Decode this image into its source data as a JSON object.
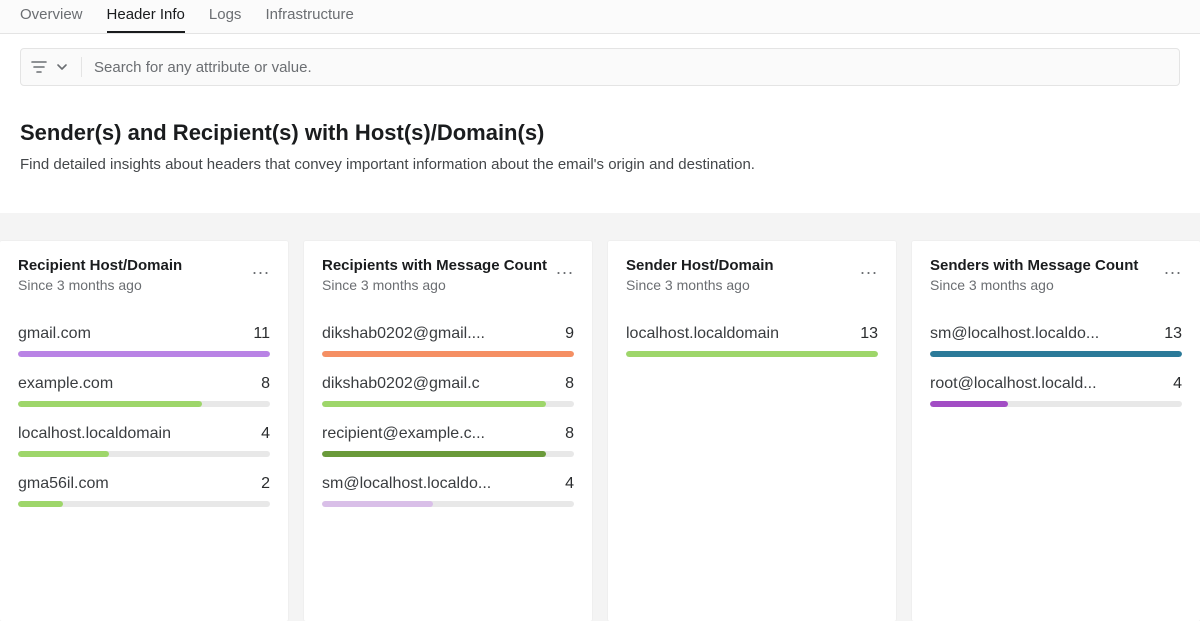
{
  "tabs": [
    {
      "label": "Overview",
      "active": false
    },
    {
      "label": "Header Info",
      "active": true
    },
    {
      "label": "Logs",
      "active": false
    },
    {
      "label": "Infrastructure",
      "active": false
    }
  ],
  "search": {
    "placeholder": "Search for any attribute or value."
  },
  "section": {
    "title": "Sender(s) and Recipient(s) with Host(s)/Domain(s)",
    "description": "Find detailed insights about headers that convey important information about the email's origin and destination."
  },
  "panels": [
    {
      "title": "Recipient Host/Domain",
      "subtitle": "Since 3 months ago",
      "max": 11,
      "items": [
        {
          "label": "gmail.com",
          "value": 11,
          "color": "#b983e5"
        },
        {
          "label": "example.com",
          "value": 8,
          "color": "#9ed66a"
        },
        {
          "label": "localhost.localdomain",
          "value": 4,
          "color": "#9ed66a"
        },
        {
          "label": "gma56il.com",
          "value": 2,
          "color": "#9ed66a"
        }
      ]
    },
    {
      "title": "Recipients with Message Count",
      "subtitle": "Since 3 months ago",
      "max": 9,
      "items": [
        {
          "label": "dikshab0202@gmail....",
          "value": 9,
          "color": "#f58f63"
        },
        {
          "label": "dikshab0202@gmail.c",
          "value": 8,
          "color": "#9ed66a"
        },
        {
          "label": "recipient@example.c...",
          "value": 8,
          "color": "#6a9a3a"
        },
        {
          "label": "sm@localhost.localdo...",
          "value": 4,
          "color": "#d9bfe8"
        }
      ]
    },
    {
      "title": "Sender Host/Domain",
      "subtitle": "Since 3 months ago",
      "max": 13,
      "items": [
        {
          "label": "localhost.localdomain",
          "value": 13,
          "color": "#9ed66a"
        }
      ]
    },
    {
      "title": "Senders with Message Count",
      "subtitle": "Since 3 months ago",
      "max": 13,
      "items": [
        {
          "label": "sm@localhost.localdo...",
          "value": 13,
          "color": "#2b7a99"
        },
        {
          "label": "root@localhost.locald...",
          "value": 4,
          "color": "#a24dc4"
        }
      ]
    }
  ],
  "chart_data": [
    {
      "type": "bar",
      "title": "Recipient Host/Domain",
      "subtitle": "Since 3 months ago",
      "categories": [
        "gmail.com",
        "example.com",
        "localhost.localdomain",
        "gma56il.com"
      ],
      "values": [
        11,
        8,
        4,
        2
      ]
    },
    {
      "type": "bar",
      "title": "Recipients with Message Count",
      "subtitle": "Since 3 months ago",
      "categories": [
        "dikshab0202@gmail....",
        "dikshab0202@gmail.c",
        "recipient@example.c...",
        "sm@localhost.localdo..."
      ],
      "values": [
        9,
        8,
        8,
        4
      ]
    },
    {
      "type": "bar",
      "title": "Sender Host/Domain",
      "subtitle": "Since 3 months ago",
      "categories": [
        "localhost.localdomain"
      ],
      "values": [
        13
      ]
    },
    {
      "type": "bar",
      "title": "Senders with Message Count",
      "subtitle": "Since 3 months ago",
      "categories": [
        "sm@localhost.localdo...",
        "root@localhost.locald..."
      ],
      "values": [
        13,
        4
      ]
    }
  ]
}
